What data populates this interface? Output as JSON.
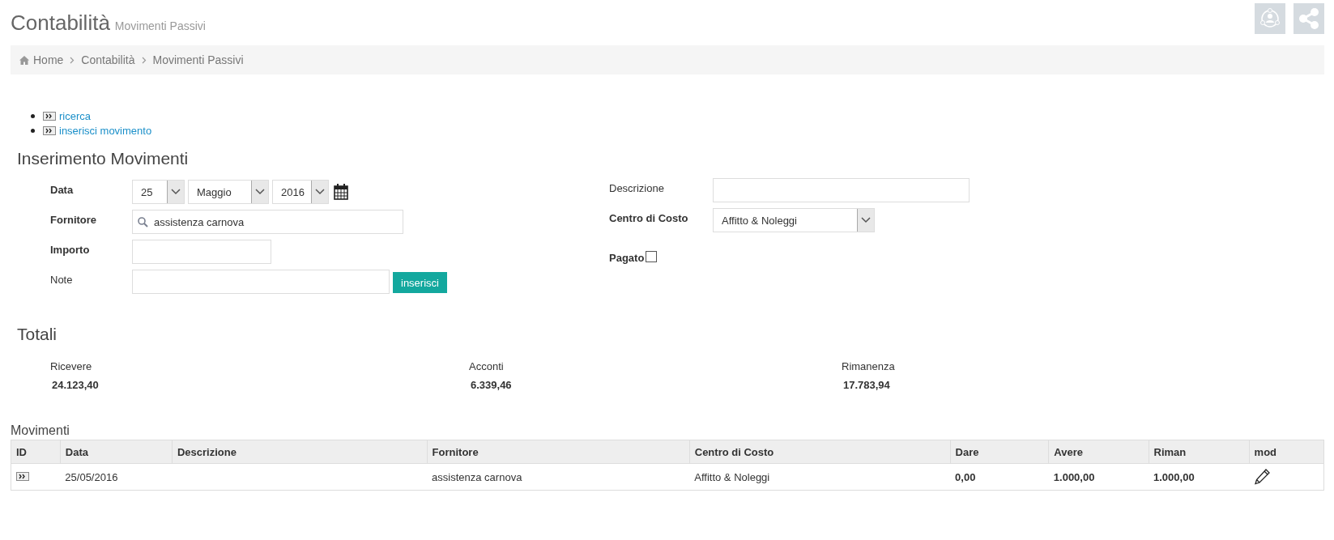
{
  "page_header": {
    "title": "Contabilità",
    "subtitle": "Movimenti Passivi"
  },
  "breadcrumb": [
    "Home",
    "Contabilità",
    "Movimenti Passivi"
  ],
  "action_links": [
    "ricerca",
    "inserisci movimento"
  ],
  "form": {
    "title": "Inserimento Movimenti",
    "left_fields": [
      {
        "kind": "date",
        "label": "Data",
        "required": true,
        "day": "25",
        "month": "Maggio",
        "year": "2016"
      },
      {
        "kind": "search",
        "label": "Fornitore",
        "required": true,
        "value": "assistenza carnova"
      },
      {
        "kind": "text",
        "label": "Importo",
        "required": true
      },
      {
        "kind": "text_button",
        "label": "Note",
        "required": false,
        "button": "inserisci"
      }
    ],
    "right_fields": [
      {
        "kind": "text",
        "label": "Descrizione",
        "required": false
      },
      {
        "kind": "select",
        "label": "Centro di Costo",
        "required": true,
        "value": "Affitto & Noleggi"
      },
      {
        "kind": "checkbox",
        "label": "Pagato",
        "required": true,
        "checked": false
      }
    ]
  },
  "totals": {
    "title": "Totali",
    "items": [
      {
        "label": "Ricevere",
        "value": "24.123,40"
      },
      {
        "label": "Acconti",
        "value": "6.339,46"
      },
      {
        "label": "Rimanenza",
        "value": "17.783,94"
      }
    ]
  },
  "table": {
    "title": "Movimenti",
    "columns": [
      "ID",
      "Data",
      "Descrizione",
      "Fornitore",
      "Centro di Costo",
      "Dare",
      "Avere",
      "Riman",
      "mod"
    ],
    "rows": [
      {
        "data": "25/05/2016",
        "fornitore": "assistenza carnova",
        "centro_di_costo": "Affitto & Noleggi",
        "dare": "0,00",
        "avere": "1.000,00",
        "riman": "1.000,00"
      }
    ]
  }
}
